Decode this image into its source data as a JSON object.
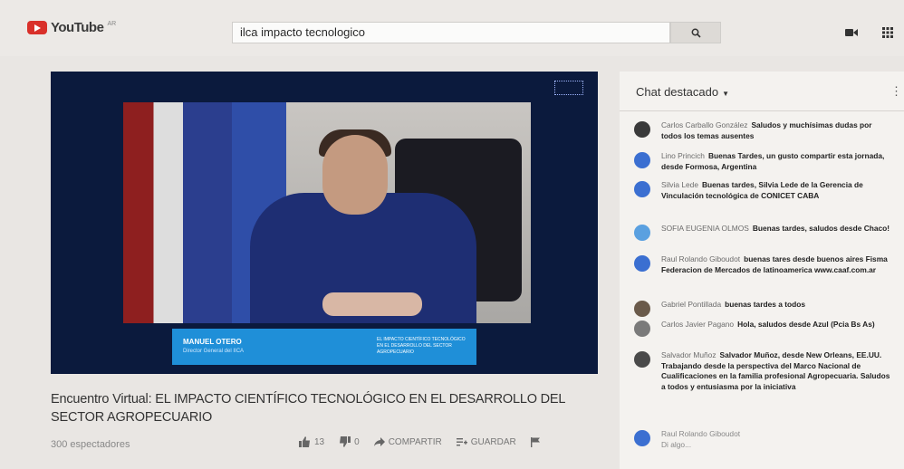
{
  "header": {
    "logo_text": "YouTube",
    "logo_sup": "AR",
    "search_value": "ilca impacto tecnologico",
    "brand_color": "#d9302a"
  },
  "video": {
    "lower_third_name": "MANUEL OTERO",
    "lower_third_sub": "Director General del IICA",
    "lower_third_right": "EL IMPACTO CIENTÍFICO TECNOLÓGICO EN EL DESARROLLO DEL SECTOR AGROPECUARIO"
  },
  "title": "Encuentro Virtual: EL IMPACTO CIENTÍFICO TECNOLÓGICO EN EL DESARROLLO DEL SECTOR AGROPECUARIO",
  "views": "300 espectadores",
  "actions": {
    "likes": "13",
    "dislikes": "0",
    "share": "COMPARTIR",
    "save": "GUARDAR"
  },
  "chat": {
    "title": "Chat destacado",
    "messages": [
      {
        "author": "Carlos Carballo González",
        "text": "Saludos y muchísimas dudas por todos los temas ausentes",
        "avatar_color": "#3a3a3a"
      },
      {
        "author": "Lino Princich",
        "text": "Buenas Tardes, un gusto compartir esta jornada, desde Formosa, Argentina",
        "avatar_color": "#3b6fd1"
      },
      {
        "author": "Silvia Lede",
        "text": "Buenas tardes, Silvia Lede de la Gerencia de Vinculación tecnológica de CONICET CABA",
        "avatar_color": "#3b6fd1"
      },
      {
        "author": "SOFIA EUGENIA OLMOS",
        "text": "Buenas tardes, saludos desde Chaco!",
        "avatar_color": "#5aa0e0"
      },
      {
        "author": "Raul Rolando Giboudot",
        "text": "buenas tares desde buenos aires Fisma Federacion de Mercados de latinoamerica www.caaf.com.ar",
        "avatar_color": "#3b6fd1"
      },
      {
        "author": "Gabriel Pontillada",
        "text": "buenas tardes a todos",
        "avatar_color": "#6a5a4a"
      },
      {
        "author": "Carlos Javier Pagano",
        "text": "Hola, saludos desde Azul (Pcia Bs As)",
        "avatar_color": "#7a7a7a"
      },
      {
        "author": "Salvador Muñoz",
        "text": "Salvador Muñoz, desde New Orleans, EE.UU. Trabajando desde la perspectiva del Marco Nacional de Cualificaciones en la familia profesional Agropecuaria. Saludos a todos y entusiasma por la iniciativa",
        "avatar_color": "#4a4a4a"
      }
    ],
    "footer_author": "Raul Rolando Giboudot",
    "footer_sub": "Di algo..."
  }
}
